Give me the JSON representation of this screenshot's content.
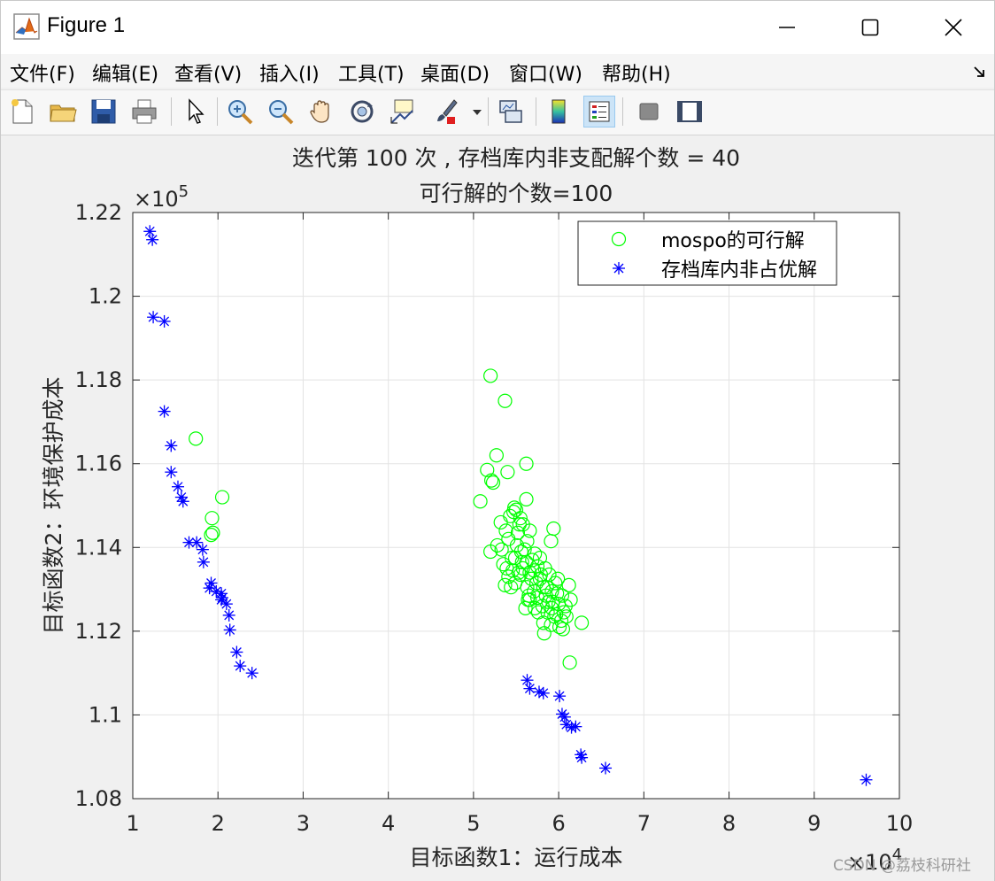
{
  "window": {
    "title": "Figure 1"
  },
  "menu": [
    "文件(F)",
    "编辑(E)",
    "查看(V)",
    "插入(I)",
    "工具(T)",
    "桌面(D)",
    "窗口(W)",
    "帮助(H)"
  ],
  "toolbar_icons": [
    "new-figure-icon",
    "open-file-icon",
    "save-icon",
    "print-icon",
    "pointer-icon",
    "zoom-in-icon",
    "zoom-out-icon",
    "pan-icon",
    "rotate-3d-icon",
    "data-cursor-icon",
    "brush-icon",
    "link-plot-icon",
    "colorbar-icon",
    "legend-icon",
    "hide-plot-tools-icon",
    "show-plot-tools-icon"
  ],
  "colors": {
    "feasible": "#00ff00",
    "archive": "#0000ff"
  },
  "watermark": "CSDN @荔枝科研社",
  "chart_data": {
    "type": "scatter",
    "title_line1": "迭代第 100 次 , 存档库内非支配解个数 = 40",
    "title_line2": "可行解的个数=100",
    "xlabel": "目标函数1：运行成本",
    "ylabel": "目标函数2：环境保护成本",
    "x_multiplier": "×10",
    "x_exponent": "4",
    "y_multiplier": "×10",
    "y_exponent": "5",
    "xlim": [
      1,
      10
    ],
    "ylim": [
      1.08,
      1.22
    ],
    "xticks": [
      "1",
      "2",
      "3",
      "4",
      "5",
      "6",
      "7",
      "8",
      "9",
      "10"
    ],
    "yticks": [
      "1.08",
      "1.1",
      "1.12",
      "1.14",
      "1.16",
      "1.18",
      "1.2",
      "1.22"
    ],
    "grid": true,
    "legend_position": "top-right",
    "series": [
      {
        "name": "mospo的可行解",
        "marker": "circle",
        "points": [
          [
            1.74,
            1.166
          ],
          [
            2.05,
            1.152
          ],
          [
            1.93,
            1.147
          ],
          [
            1.92,
            1.143
          ],
          [
            1.94,
            1.1435
          ],
          [
            5.2,
            1.181
          ],
          [
            5.37,
            1.175
          ],
          [
            5.27,
            1.162
          ],
          [
            5.62,
            1.16
          ],
          [
            5.16,
            1.1585
          ],
          [
            5.4,
            1.158
          ],
          [
            5.21,
            1.156
          ],
          [
            5.23,
            1.1555
          ],
          [
            5.08,
            1.151
          ],
          [
            5.62,
            1.1515
          ],
          [
            5.5,
            1.149
          ],
          [
            5.47,
            1.1485
          ],
          [
            5.43,
            1.1475
          ],
          [
            5.55,
            1.147
          ],
          [
            5.32,
            1.146
          ],
          [
            5.58,
            1.1455
          ],
          [
            5.66,
            1.144
          ],
          [
            5.38,
            1.144
          ],
          [
            5.52,
            1.1435
          ],
          [
            5.94,
            1.1445
          ],
          [
            5.41,
            1.142
          ],
          [
            5.63,
            1.1415
          ],
          [
            5.28,
            1.1405
          ],
          [
            5.33,
            1.1395
          ],
          [
            5.56,
            1.139
          ],
          [
            5.72,
            1.1385
          ],
          [
            5.91,
            1.1415
          ],
          [
            5.2,
            1.139
          ],
          [
            5.49,
            1.1375
          ],
          [
            5.62,
            1.1365
          ],
          [
            5.35,
            1.136
          ],
          [
            5.75,
            1.1355
          ],
          [
            5.58,
            1.135
          ],
          [
            5.46,
            1.1345
          ],
          [
            5.84,
            1.135
          ],
          [
            5.66,
            1.134
          ],
          [
            5.41,
            1.133
          ],
          [
            5.55,
            1.1335
          ],
          [
            5.78,
            1.1325
          ],
          [
            5.99,
            1.1325
          ],
          [
            5.37,
            1.131
          ],
          [
            5.63,
            1.1305
          ],
          [
            5.86,
            1.1305
          ],
          [
            5.71,
            1.1295
          ],
          [
            6.12,
            1.131
          ],
          [
            5.92,
            1.1295
          ],
          [
            5.49,
            1.1315
          ],
          [
            5.75,
            1.128
          ],
          [
            5.98,
            1.129
          ],
          [
            5.66,
            1.1275
          ],
          [
            6.14,
            1.1275
          ],
          [
            5.88,
            1.127
          ],
          [
            5.61,
            1.1255
          ],
          [
            5.81,
            1.126
          ],
          [
            6.06,
            1.1245
          ],
          [
            5.97,
            1.124
          ],
          [
            5.72,
            1.1255
          ],
          [
            6.03,
            1.1225
          ],
          [
            5.82,
            1.122
          ],
          [
            6.27,
            1.122
          ],
          [
            5.91,
            1.1215
          ],
          [
            6.05,
            1.1205
          ],
          [
            5.83,
            1.1195
          ],
          [
            6.01,
            1.121
          ],
          [
            6.13,
            1.1125
          ],
          [
            5.53,
            1.134
          ],
          [
            5.69,
            1.137
          ],
          [
            5.79,
            1.1335
          ],
          [
            5.45,
            1.1375
          ],
          [
            5.93,
            1.127
          ],
          [
            5.65,
            1.1285
          ],
          [
            6.08,
            1.126
          ],
          [
            5.74,
            1.1315
          ],
          [
            5.51,
            1.1405
          ],
          [
            5.85,
            1.1285
          ],
          [
            5.39,
            1.135
          ],
          [
            5.95,
            1.1235
          ],
          [
            5.68,
            1.1325
          ],
          [
            5.57,
            1.1365
          ],
          [
            5.89,
            1.1335
          ],
          [
            6.0,
            1.1265
          ],
          [
            5.76,
            1.1245
          ],
          [
            5.44,
            1.1305
          ],
          [
            5.82,
            1.1305
          ],
          [
            5.6,
            1.1395
          ],
          [
            5.71,
            1.1345
          ],
          [
            5.96,
            1.1315
          ],
          [
            6.09,
            1.1235
          ],
          [
            5.87,
            1.1245
          ],
          [
            5.54,
            1.1455
          ],
          [
            5.48,
            1.1495
          ],
          [
            5.64,
            1.1275
          ],
          [
            5.78,
            1.1375
          ],
          [
            6.04,
            1.1285
          ],
          [
            5.92,
            1.1255
          ]
        ]
      },
      {
        "name": "存档库内非占优解",
        "marker": "asterisk",
        "points": [
          [
            1.2,
            1.2155
          ],
          [
            1.23,
            1.2135
          ],
          [
            1.24,
            1.195
          ],
          [
            1.37,
            1.194
          ],
          [
            1.37,
            1.1725
          ],
          [
            1.45,
            1.1643
          ],
          [
            1.45,
            1.158
          ],
          [
            1.53,
            1.1545
          ],
          [
            1.57,
            1.152
          ],
          [
            1.59,
            1.151
          ],
          [
            1.66,
            1.1412
          ],
          [
            1.75,
            1.1412
          ],
          [
            1.82,
            1.1395
          ],
          [
            1.83,
            1.1365
          ],
          [
            1.92,
            1.1315
          ],
          [
            1.98,
            1.1295
          ],
          [
            2.05,
            1.128
          ],
          [
            2.04,
            1.1275
          ],
          [
            2.1,
            1.1265
          ],
          [
            2.13,
            1.1238
          ],
          [
            2.14,
            1.1203
          ],
          [
            2.22,
            1.115
          ],
          [
            2.26,
            1.1117
          ],
          [
            2.4,
            1.11
          ],
          [
            2.04,
            1.129
          ],
          [
            5.63,
            1.1083
          ],
          [
            5.66,
            1.1063
          ],
          [
            5.77,
            1.1055
          ],
          [
            5.82,
            1.1052
          ],
          [
            6.01,
            1.1045
          ],
          [
            6.04,
            1.1002
          ],
          [
            6.07,
            1.0995
          ],
          [
            6.09,
            1.0977
          ],
          [
            6.15,
            1.097
          ],
          [
            6.26,
            1.0905
          ],
          [
            6.27,
            1.0898
          ],
          [
            6.55,
            1.0873
          ],
          [
            9.61,
            1.0845
          ],
          [
            1.9,
            1.1303
          ],
          [
            6.2,
            1.0972
          ]
        ]
      }
    ]
  }
}
